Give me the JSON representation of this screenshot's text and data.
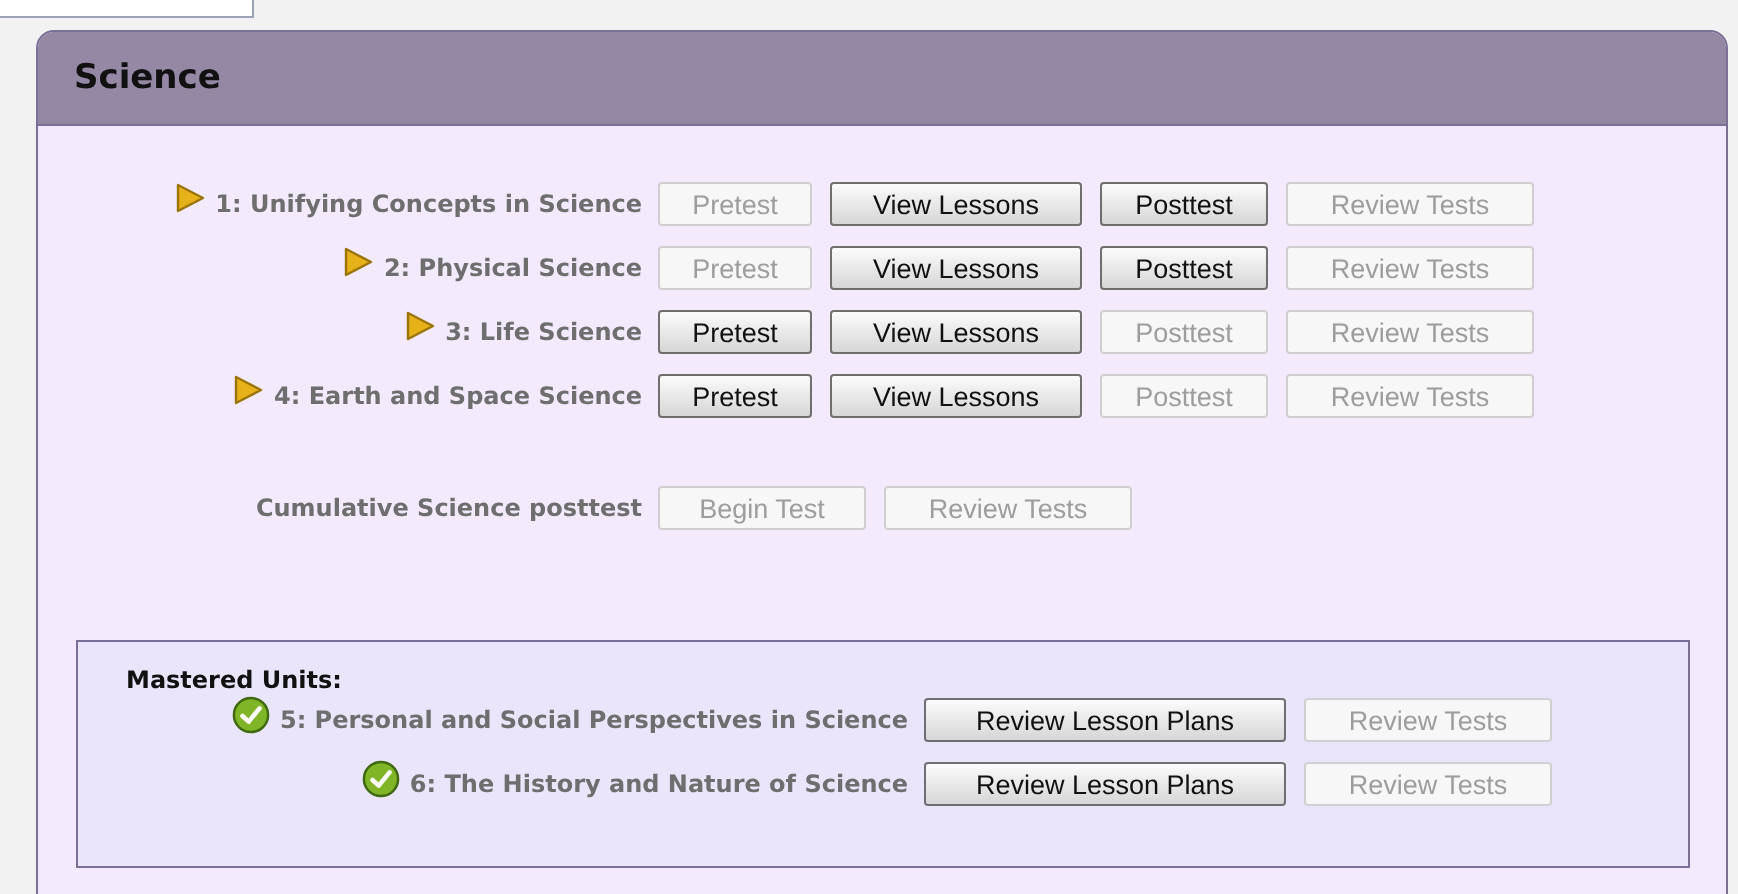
{
  "panel": {
    "title": "Science"
  },
  "units": [
    {
      "label": "1: Unifying Concepts in Science",
      "buttons": [
        {
          "label": "Pretest",
          "disabled": true
        },
        {
          "label": "View Lessons",
          "disabled": false
        },
        {
          "label": "Posttest",
          "disabled": false
        },
        {
          "label": "Review Tests",
          "disabled": true
        }
      ]
    },
    {
      "label": "2: Physical Science",
      "buttons": [
        {
          "label": "Pretest",
          "disabled": true
        },
        {
          "label": "View Lessons",
          "disabled": false
        },
        {
          "label": "Posttest",
          "disabled": false
        },
        {
          "label": "Review Tests",
          "disabled": true
        }
      ]
    },
    {
      "label": "3: Life Science",
      "buttons": [
        {
          "label": "Pretest",
          "disabled": false
        },
        {
          "label": "View Lessons",
          "disabled": false
        },
        {
          "label": "Posttest",
          "disabled": true
        },
        {
          "label": "Review Tests",
          "disabled": true
        }
      ]
    },
    {
      "label": "4: Earth and Space Science",
      "buttons": [
        {
          "label": "Pretest",
          "disabled": false
        },
        {
          "label": "View Lessons",
          "disabled": false
        },
        {
          "label": "Posttest",
          "disabled": true
        },
        {
          "label": "Review Tests",
          "disabled": true
        }
      ]
    }
  ],
  "cumulative": {
    "label": "Cumulative Science posttest",
    "buttons": [
      {
        "label": "Begin Test",
        "disabled": true
      },
      {
        "label": "Review Tests",
        "disabled": true
      }
    ]
  },
  "mastered": {
    "heading": "Mastered Units:",
    "units": [
      {
        "label": "5: Personal and Social Perspectives in Science",
        "buttons": [
          {
            "label": "Review Lesson Plans",
            "disabled": false
          },
          {
            "label": "Review Tests",
            "disabled": true
          }
        ]
      },
      {
        "label": "6: The History and Nature of Science",
        "buttons": [
          {
            "label": "Review Lesson Plans",
            "disabled": false
          },
          {
            "label": "Review Tests",
            "disabled": true
          }
        ]
      }
    ]
  }
}
